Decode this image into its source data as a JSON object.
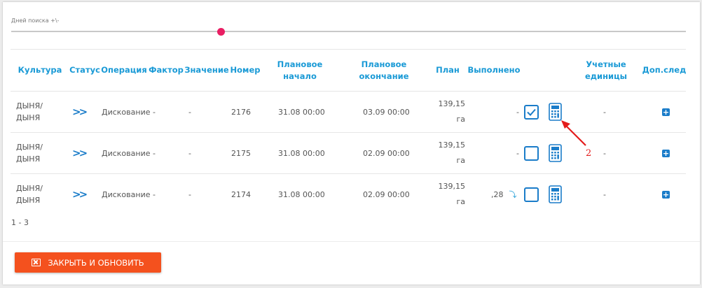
{
  "slider": {
    "label": "Дней поиска +\\-"
  },
  "columns": {
    "culture": "Культура",
    "status": "Статус",
    "operation": "Операция",
    "factor": "Фактор",
    "value": "Значение",
    "number": "Номер",
    "plan_start": "Плановое начало",
    "plan_end": "Плановое окончание",
    "plan": "План",
    "done": "Выполнено",
    "units": "Учетные единицы",
    "extra": "Доп.след"
  },
  "rows": [
    {
      "culture": "ДЫНЯ/ ДЫНЯ",
      "status_icon": "double-chevron-right-icon",
      "operation": "Дискование",
      "factor": "-",
      "value": "-",
      "number": "2176",
      "plan_start": "31.08 00:00",
      "plan_end": "03.09 00:00",
      "plan": "139,15 га",
      "done": "-",
      "checked": true,
      "units": "-"
    },
    {
      "culture": "ДЫНЯ/ ДЫНЯ",
      "status_icon": "double-chevron-right-icon",
      "operation": "Дискование",
      "factor": "-",
      "value": "-",
      "number": "2175",
      "plan_start": "31.08 00:00",
      "plan_end": "02.09 00:00",
      "plan": "139,15 га",
      "done": "-",
      "checked": false,
      "units": "-"
    },
    {
      "culture": "ДЫНЯ/ ДЫНЯ",
      "status_icon": "double-chevron-right-icon",
      "operation": "Дискование",
      "factor": "-",
      "value": "-",
      "number": "2174",
      "plan_start": "31.08 00:00",
      "plan_end": "02.09 00:00",
      "plan": "139,15 га",
      "done": ",28",
      "checked": false,
      "units": "-"
    }
  ],
  "pager": {
    "range": "1 - 3"
  },
  "footer": {
    "close_label": "ЗАКРЫТЬ И ОБНОВИТЬ"
  },
  "annotation": {
    "number": "2"
  },
  "colors": {
    "accent": "#1a9ad6",
    "icon": "#1a7cc9",
    "slider_thumb": "#e91e63",
    "button": "#f4511e",
    "annotation": "#e41b1b"
  }
}
